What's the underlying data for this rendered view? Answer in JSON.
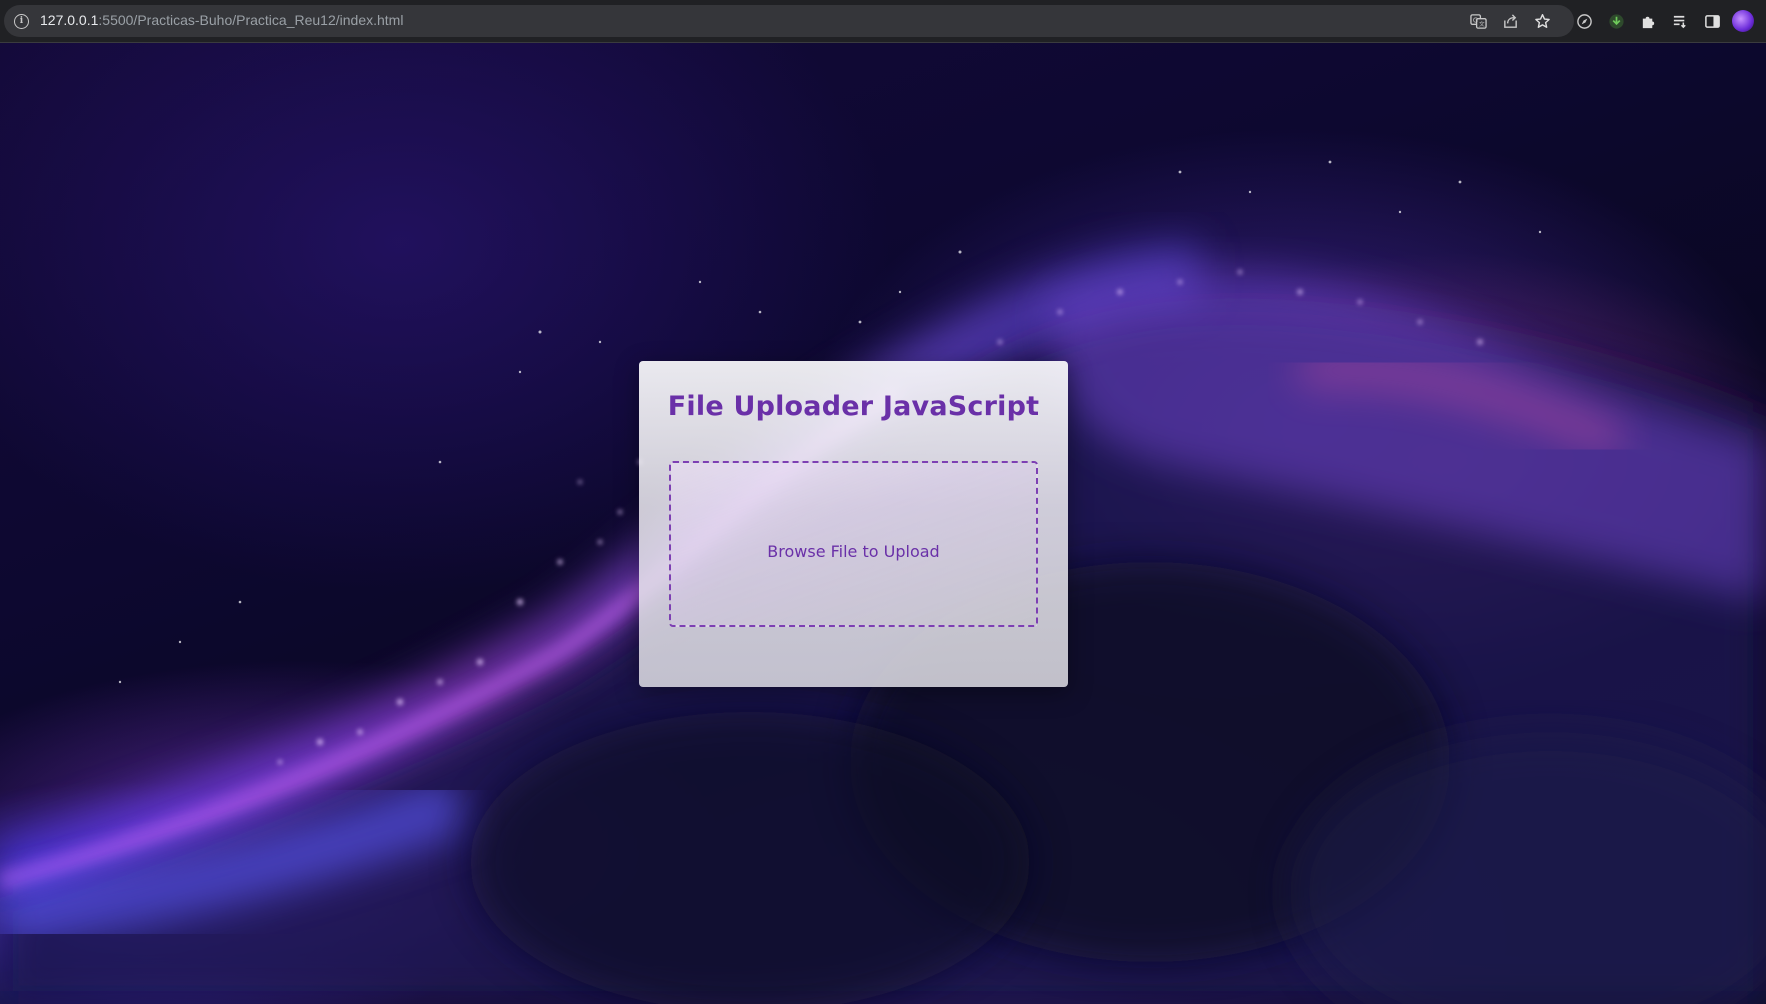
{
  "browser": {
    "url_host": "127.0.0.1",
    "url_rest": ":5500/Practicas-Buho/Practica_Reu12/index.html",
    "icons": [
      "info-icon",
      "translate-icon",
      "share-icon",
      "bookmark-star-icon",
      "compass-extension-icon",
      "download-extension-icon",
      "puzzle-extensions-icon",
      "reading-list-icon",
      "side-panel-icon",
      "profile-avatar"
    ]
  },
  "uploader": {
    "title": "File Uploader JavaScript",
    "browse_label": "Browse File to Upload"
  },
  "colors": {
    "accent": "#6a30a8",
    "dash_border": "#7d3fb3"
  }
}
